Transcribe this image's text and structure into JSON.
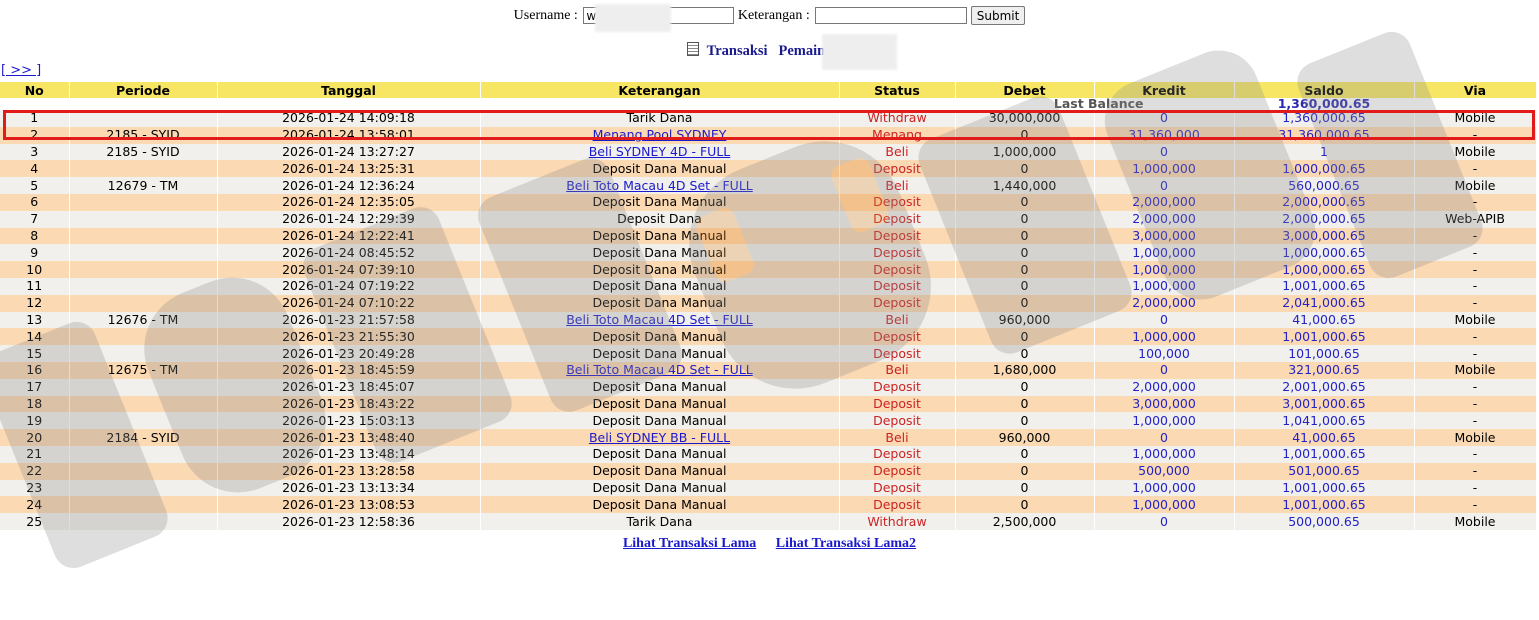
{
  "search": {
    "username_label": "Username :",
    "username_value": "w",
    "keterangan_label": "Keterangan :",
    "keterangan_value": "",
    "submit_label": "Submit"
  },
  "heading": {
    "title": "Transaksi",
    "player_label": "Pemain : wi"
  },
  "nav": {
    "next_label": "[ >> ]"
  },
  "table": {
    "headers": [
      "No",
      "Periode",
      "Tanggal",
      "Keterangan",
      "Status",
      "Debet",
      "Kredit",
      "Saldo",
      "Via"
    ],
    "last_balance_label": "Last Balance",
    "last_balance_value": "1,360,000.65",
    "rows": [
      {
        "no": "1",
        "periode": "",
        "tanggal": "2026-01-24 14:09:18",
        "keterangan": "Tarik Dana",
        "link": false,
        "status": "Withdraw",
        "debet": "30,000,000",
        "kredit": "0",
        "saldo": "1,360,000.65",
        "via": "Mobile"
      },
      {
        "no": "2",
        "periode": "2185 - SYID",
        "tanggal": "2026-01-24 13:58:01",
        "keterangan": "Menang Pool SYDNEY",
        "link": true,
        "status": "Menang",
        "debet": "0",
        "kredit": "31,360,000",
        "saldo": "31,360,000.65",
        "via": "-"
      },
      {
        "no": "3",
        "periode": "2185 - SYID",
        "tanggal": "2026-01-24 13:27:27",
        "keterangan": "Beli SYDNEY 4D - FULL",
        "link": true,
        "status": "Beli",
        "debet": "1,000,000",
        "kredit": "0",
        "saldo": "1",
        "via": "Mobile"
      },
      {
        "no": "4",
        "periode": "",
        "tanggal": "2026-01-24 13:25:31",
        "keterangan": "Deposit Dana Manual",
        "link": false,
        "status": "Deposit",
        "debet": "0",
        "kredit": "1,000,000",
        "saldo": "1,000,000.65",
        "via": "-"
      },
      {
        "no": "5",
        "periode": "12679 - TM",
        "tanggal": "2026-01-24 12:36:24",
        "keterangan": "Beli Toto Macau 4D Set - FULL",
        "link": true,
        "status": "Beli",
        "debet": "1,440,000",
        "kredit": "0",
        "saldo": "560,000.65",
        "via": "Mobile"
      },
      {
        "no": "6",
        "periode": "",
        "tanggal": "2026-01-24 12:35:05",
        "keterangan": "Deposit Dana Manual",
        "link": false,
        "status": "Deposit",
        "debet": "0",
        "kredit": "2,000,000",
        "saldo": "2,000,000.65",
        "via": "-"
      },
      {
        "no": "7",
        "periode": "",
        "tanggal": "2026-01-24 12:29:39",
        "keterangan": "Deposit Dana",
        "link": false,
        "status": "Deposit",
        "debet": "0",
        "kredit": "2,000,000",
        "saldo": "2,000,000.65",
        "via": "Web-APIB"
      },
      {
        "no": "8",
        "periode": "",
        "tanggal": "2026-01-24 12:22:41",
        "keterangan": "Deposit Dana Manual",
        "link": false,
        "status": "Deposit",
        "debet": "0",
        "kredit": "3,000,000",
        "saldo": "3,000,000.65",
        "via": "-"
      },
      {
        "no": "9",
        "periode": "",
        "tanggal": "2026-01-24 08:45:52",
        "keterangan": "Deposit Dana Manual",
        "link": false,
        "status": "Deposit",
        "debet": "0",
        "kredit": "1,000,000",
        "saldo": "1,000,000.65",
        "via": "-"
      },
      {
        "no": "10",
        "periode": "",
        "tanggal": "2026-01-24 07:39:10",
        "keterangan": "Deposit Dana Manual",
        "link": false,
        "status": "Deposit",
        "debet": "0",
        "kredit": "1,000,000",
        "saldo": "1,000,000.65",
        "via": "-"
      },
      {
        "no": "11",
        "periode": "",
        "tanggal": "2026-01-24 07:19:22",
        "keterangan": "Deposit Dana Manual",
        "link": false,
        "status": "Deposit",
        "debet": "0",
        "kredit": "1,000,000",
        "saldo": "1,001,000.65",
        "via": "-"
      },
      {
        "no": "12",
        "periode": "",
        "tanggal": "2026-01-24 07:10:22",
        "keterangan": "Deposit Dana Manual",
        "link": false,
        "status": "Deposit",
        "debet": "0",
        "kredit": "2,000,000",
        "saldo": "2,041,000.65",
        "via": "-"
      },
      {
        "no": "13",
        "periode": "12676 - TM",
        "tanggal": "2026-01-23 21:57:58",
        "keterangan": "Beli Toto Macau 4D Set - FULL",
        "link": true,
        "status": "Beli",
        "debet": "960,000",
        "kredit": "0",
        "saldo": "41,000.65",
        "via": "Mobile"
      },
      {
        "no": "14",
        "periode": "",
        "tanggal": "2026-01-23 21:55:30",
        "keterangan": "Deposit Dana Manual",
        "link": false,
        "status": "Deposit",
        "debet": "0",
        "kredit": "1,000,000",
        "saldo": "1,001,000.65",
        "via": "-"
      },
      {
        "no": "15",
        "periode": "",
        "tanggal": "2026-01-23 20:49:28",
        "keterangan": "Deposit Dana Manual",
        "link": false,
        "status": "Deposit",
        "debet": "0",
        "kredit": "100,000",
        "saldo": "101,000.65",
        "via": "-"
      },
      {
        "no": "16",
        "periode": "12675 - TM",
        "tanggal": "2026-01-23 18:45:59",
        "keterangan": "Beli Toto Macau 4D Set - FULL",
        "link": true,
        "status": "Beli",
        "debet": "1,680,000",
        "kredit": "0",
        "saldo": "321,000.65",
        "via": "Mobile"
      },
      {
        "no": "17",
        "periode": "",
        "tanggal": "2026-01-23 18:45:07",
        "keterangan": "Deposit Dana Manual",
        "link": false,
        "status": "Deposit",
        "debet": "0",
        "kredit": "2,000,000",
        "saldo": "2,001,000.65",
        "via": "-"
      },
      {
        "no": "18",
        "periode": "",
        "tanggal": "2026-01-23 18:43:22",
        "keterangan": "Deposit Dana Manual",
        "link": false,
        "status": "Deposit",
        "debet": "0",
        "kredit": "3,000,000",
        "saldo": "3,001,000.65",
        "via": "-"
      },
      {
        "no": "19",
        "periode": "",
        "tanggal": "2026-01-23 15:03:13",
        "keterangan": "Deposit Dana Manual",
        "link": false,
        "status": "Deposit",
        "debet": "0",
        "kredit": "1,000,000",
        "saldo": "1,041,000.65",
        "via": "-"
      },
      {
        "no": "20",
        "periode": "2184 - SYID",
        "tanggal": "2026-01-23 13:48:40",
        "keterangan": "Beli SYDNEY BB - FULL",
        "link": true,
        "status": "Beli",
        "debet": "960,000",
        "kredit": "0",
        "saldo": "41,000.65",
        "via": "Mobile"
      },
      {
        "no": "21",
        "periode": "",
        "tanggal": "2026-01-23 13:48:14",
        "keterangan": "Deposit Dana Manual",
        "link": false,
        "status": "Deposit",
        "debet": "0",
        "kredit": "1,000,000",
        "saldo": "1,001,000.65",
        "via": "-"
      },
      {
        "no": "22",
        "periode": "",
        "tanggal": "2026-01-23 13:28:58",
        "keterangan": "Deposit Dana Manual",
        "link": false,
        "status": "Deposit",
        "debet": "0",
        "kredit": "500,000",
        "saldo": "501,000.65",
        "via": "-"
      },
      {
        "no": "23",
        "periode": "",
        "tanggal": "2026-01-23 13:13:34",
        "keterangan": "Deposit Dana Manual",
        "link": false,
        "status": "Deposit",
        "debet": "0",
        "kredit": "1,000,000",
        "saldo": "1,001,000.65",
        "via": "-"
      },
      {
        "no": "24",
        "periode": "",
        "tanggal": "2026-01-23 13:08:53",
        "keterangan": "Deposit Dana Manual",
        "link": false,
        "status": "Deposit",
        "debet": "0",
        "kredit": "1,000,000",
        "saldo": "1,001,000.65",
        "via": "-"
      },
      {
        "no": "25",
        "periode": "",
        "tanggal": "2026-01-23 12:58:36",
        "keterangan": "Tarik Dana",
        "link": false,
        "status": "Withdraw",
        "debet": "2,500,000",
        "kredit": "0",
        "saldo": "500,000.65",
        "via": "Mobile"
      }
    ]
  },
  "footer": {
    "link_1": "Lihat Transaksi Lama",
    "link_2": "Lihat Transaksi Lama2"
  },
  "colors": {
    "header_bg": "#f6e664",
    "row_alt_bg": "#fbd9b3",
    "row_bg": "#f1f0ec",
    "status_red": "#cc2222",
    "value_blue": "#2323c8",
    "highlight_red": "#e11a1a"
  }
}
